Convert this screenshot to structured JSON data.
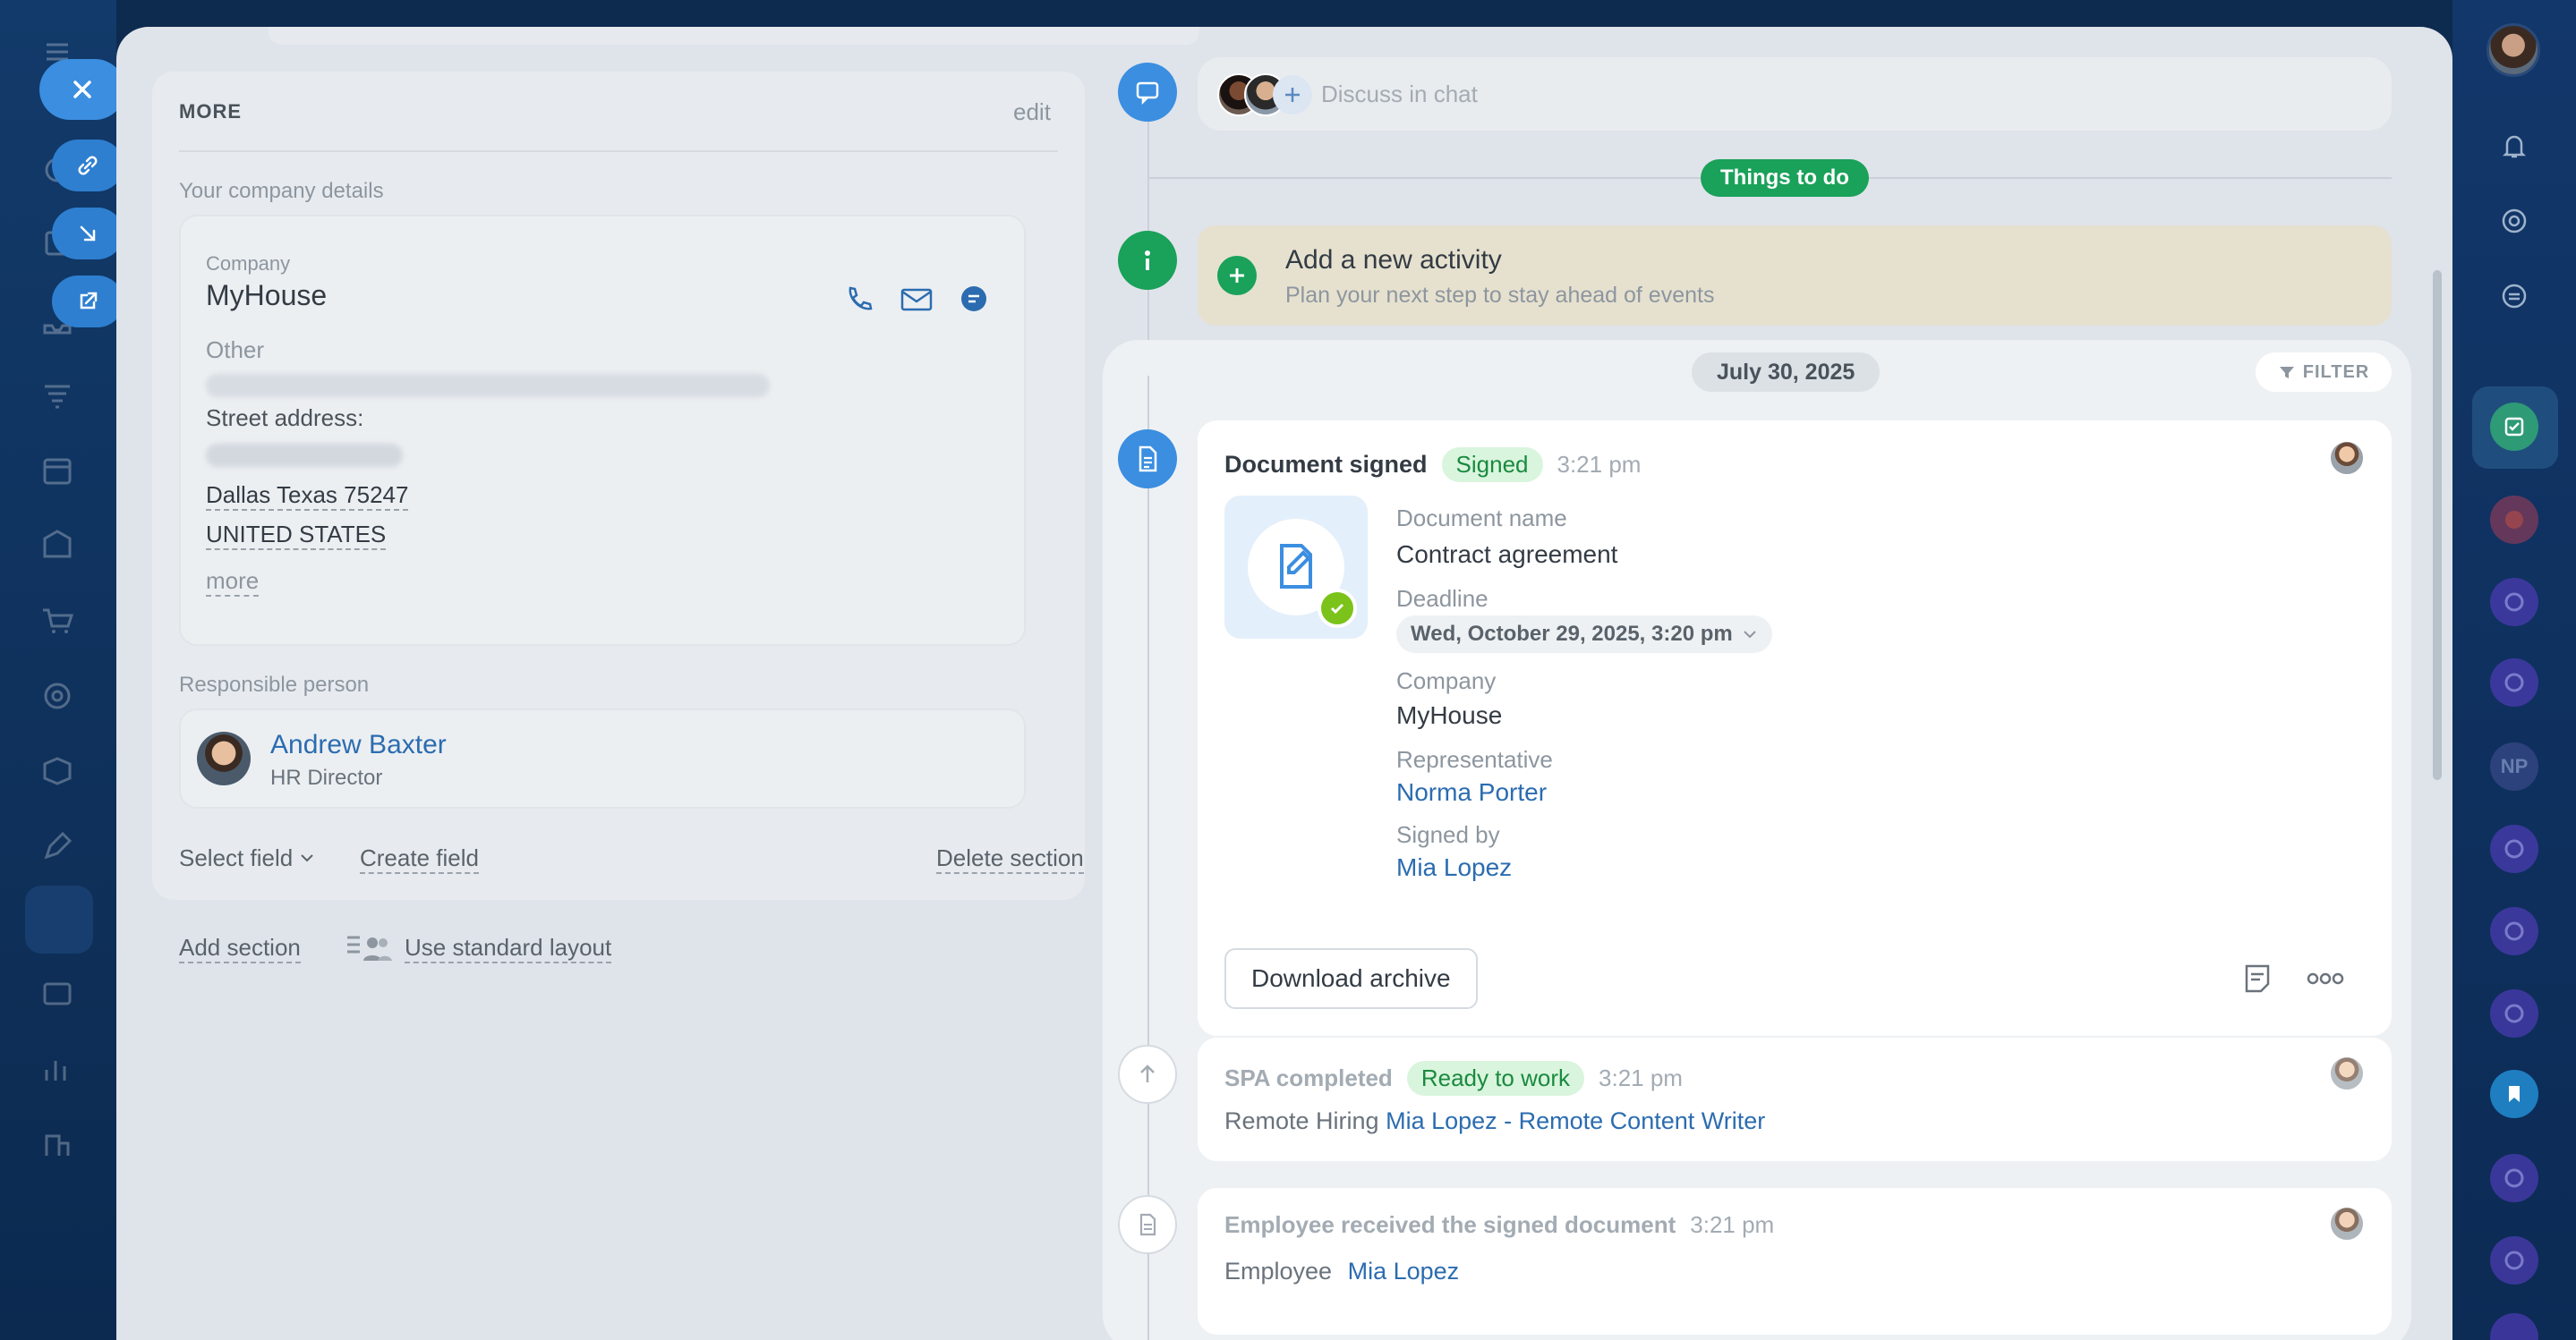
{
  "left_panel": {
    "more_section": {
      "title": "MORE",
      "edit_label": "edit",
      "company_details_label": "Your company details",
      "company_label": "Company",
      "company_name": "MyHouse",
      "other_label": "Other",
      "street_label": "Street address:",
      "address_line1": "Dallas Texas 75247",
      "address_line2": "UNITED STATES",
      "more_link": "more",
      "responsible_label": "Responsible person",
      "responsible_name": "Andrew Baxter",
      "responsible_title": "HR Director",
      "select_field": "Select field",
      "create_field": "Create field",
      "delete_section": "Delete section"
    },
    "add_section": "Add section",
    "use_standard_layout": "Use standard layout"
  },
  "timeline": {
    "chat_placeholder": "Discuss in chat",
    "things_to_do": "Things to do",
    "add_activity_title": "Add a new activity",
    "add_activity_subtitle": "Plan your next step to stay ahead of events",
    "date_label": "July 30, 2025",
    "filter_label": "FILTER",
    "document_entry": {
      "title": "Document signed",
      "badge": "Signed",
      "time": "3:21 pm",
      "doc_name_label": "Document name",
      "doc_name": "Contract agreement",
      "deadline_label": "Deadline",
      "deadline_value": "Wed, October 29, 2025, 3:20 pm",
      "company_label": "Company",
      "company_value": "MyHouse",
      "representative_label": "Representative",
      "representative_value": "Norma Porter",
      "signed_by_label": "Signed by",
      "signed_by_value": "Mia Lopez",
      "download_button": "Download archive"
    },
    "spa_entry": {
      "title": "SPA completed",
      "badge": "Ready to work",
      "time": "3:21 pm",
      "prefix": "Remote Hiring",
      "link": "Mia Lopez - Remote Content Writer"
    },
    "employee_entry": {
      "title": "Employee received the signed document",
      "time": "3:21 pm",
      "prefix": "Employee",
      "link": "Mia Lopez"
    }
  },
  "right_sidebar": {
    "np_label": "NP"
  },
  "colors": {
    "accent_blue": "#3b8ee0",
    "success_green": "#1aa15a",
    "link_blue": "#2b6cb0",
    "badge_green_bg": "#d9f5dd",
    "badge_green_text": "#1a8a3f"
  }
}
